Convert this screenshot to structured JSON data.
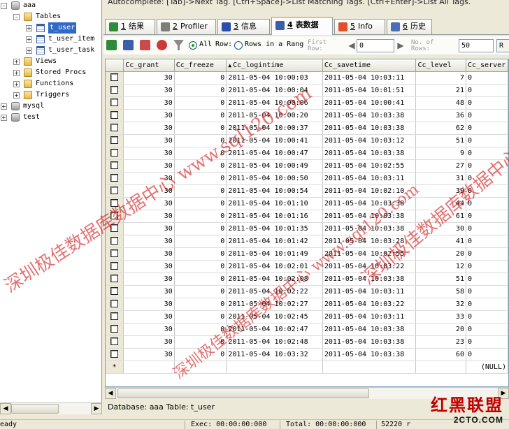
{
  "tree": {
    "items": [
      {
        "label": "aaa",
        "icon": "database-icon",
        "level": 0,
        "expander": "-"
      },
      {
        "label": "Tables",
        "icon": "folder-icon",
        "level": 1,
        "expander": "-"
      },
      {
        "label": "t_user",
        "icon": "table-icon",
        "level": 2,
        "expander": "+",
        "selected": true
      },
      {
        "label": "t_user_item",
        "icon": "table-icon",
        "level": 2,
        "expander": "+"
      },
      {
        "label": "t_user_task",
        "icon": "table-icon",
        "level": 2,
        "expander": "+"
      },
      {
        "label": "Views",
        "icon": "folder-icon",
        "level": 1,
        "expander": "+"
      },
      {
        "label": "Stored Procs",
        "icon": "folder-icon",
        "level": 1,
        "expander": "+"
      },
      {
        "label": "Functions",
        "icon": "folder-icon",
        "level": 1,
        "expander": "+"
      },
      {
        "label": "Triggers",
        "icon": "folder-icon",
        "level": 1,
        "expander": "+"
      },
      {
        "label": "mysql",
        "icon": "database-icon",
        "level": 0,
        "expander": "+"
      },
      {
        "label": "test",
        "icon": "database-icon",
        "level": 0,
        "expander": "+"
      }
    ]
  },
  "autocomplete_hint": "Autocomplete: [Tab]->Next Tag. [Ctrl+Space]->List Matching Tags. [Ctrl+Enter]->List All Tags.",
  "tabs": [
    {
      "num": "1",
      "label": "结果",
      "icon": "grid-icon",
      "color": "#2f8a3a"
    },
    {
      "num": "2",
      "label": "Profiler",
      "icon": "profiler-icon",
      "color": "#7d7d7d"
    },
    {
      "num": "3",
      "label": "信息",
      "icon": "info-icon",
      "color": "#2b4fa8"
    },
    {
      "num": "4",
      "label": "表数据",
      "icon": "table-data-icon",
      "color": "#3b5fa6",
      "active": true
    },
    {
      "num": "5",
      "label": "Info",
      "icon": "objects-icon",
      "color": "#e0502a"
    },
    {
      "num": "6",
      "label": "历史",
      "icon": "history-icon",
      "color": "#4a6fb5"
    }
  ],
  "toolbar": {
    "all_rows_label": "All",
    "row_label": "Row:",
    "rows_in_range_label": "Rows in a Rang",
    "first_row_label": "First\nRow:",
    "first_row_value": "0",
    "no_of_rows_label": "No. of\nRows:",
    "no_of_rows_value": "50",
    "refresh_label": "R"
  },
  "grid": {
    "columns": [
      "Cc_grant",
      "Cc_freeze",
      "Cc_logintime",
      "Cc_savetime",
      "Cc_level",
      "Cc_server"
    ],
    "sorted_column": "Cc_logintime",
    "rows": [
      [
        "30",
        "0",
        "2011-05-04 10:00:03",
        "2011-05-04 10:03:11",
        "7",
        "0"
      ],
      [
        "30",
        "0",
        "2011-05-04 10:00:04",
        "2011-05-04 10:01:51",
        "21",
        "0"
      ],
      [
        "30",
        "0",
        "2011-05-04 10:00:06",
        "2011-05-04 10:00:41",
        "48",
        "0"
      ],
      [
        "30",
        "0",
        "2011-05-04 10:00:20",
        "2011-05-04 10:03:38",
        "36",
        "0"
      ],
      [
        "30",
        "0",
        "2011-05-04 10:00:37",
        "2011-05-04 10:03:38",
        "62",
        "0"
      ],
      [
        "30",
        "0",
        "2011-05-04 10:00:41",
        "2011-05-04 10:03:12",
        "51",
        "0"
      ],
      [
        "30",
        "0",
        "2011-05-04 10:00:47",
        "2011-05-04 10:03:38",
        "9",
        "0"
      ],
      [
        "30",
        "0",
        "2011-05-04 10:00:49",
        "2011-05-04 10:02:55",
        "27",
        "0"
      ],
      [
        "30",
        "0",
        "2011-05-04 10:00:50",
        "2011-05-04 10:03:11",
        "31",
        "0"
      ],
      [
        "30",
        "0",
        "2011-05-04 10:00:54",
        "2011-05-04 10:02:10",
        "39",
        "0"
      ],
      [
        "30",
        "0",
        "2011-05-04 10:01:10",
        "2011-05-04 10:03:38",
        "44",
        "0"
      ],
      [
        "30",
        "0",
        "2011-05-04 10:01:16",
        "2011-05-04 10:03:38",
        "61",
        "0"
      ],
      [
        "30",
        "0",
        "2011-05-04 10:01:35",
        "2011-05-04 10:03:38",
        "30",
        "0"
      ],
      [
        "30",
        "0",
        "2011-05-04 10:01:42",
        "2011-05-04 10:03:28",
        "41",
        "0"
      ],
      [
        "30",
        "0",
        "2011-05-04 10:01:49",
        "2011-05-04 10:02:55",
        "20",
        "0"
      ],
      [
        "30",
        "0",
        "2011-05-04 10:02:01",
        "2011-05-04 10:03:22",
        "12",
        "0"
      ],
      [
        "30",
        "0",
        "2011-05-04 10:02:08",
        "2011-05-04 10:03:38",
        "51",
        "0"
      ],
      [
        "30",
        "0",
        "2011-05-04 10:02:22",
        "2011-05-04 10:03:11",
        "58",
        "0"
      ],
      [
        "30",
        "0",
        "2011-05-04 10:02:27",
        "2011-05-04 10:03:22",
        "32",
        "0"
      ],
      [
        "30",
        "0",
        "2011-05-04 10:02:45",
        "2011-05-04 10:03:11",
        "33",
        "0"
      ],
      [
        "30",
        "0",
        "2011-05-04 10:02:47",
        "2011-05-04 10:03:38",
        "20",
        "0"
      ],
      [
        "30",
        "0",
        "2011-05-04 10:02:48",
        "2011-05-04 10:03:38",
        "23",
        "0"
      ],
      [
        "30",
        "0",
        "2011-05-04 10:03:32",
        "2011-05-04 10:03:38",
        "60",
        "0"
      ]
    ],
    "new_row_marker": "*",
    "null_text": "(NULL)"
  },
  "db_info": "Database: aaa Table: t_user",
  "status": {
    "ready": "eady",
    "exec": "Exec: 00:00:00:000",
    "total": "Total: 00:00:00:000",
    "rows": "52220 r"
  },
  "watermark": {
    "text_1": "深圳极佳数据库数据中心 www.sql120.com",
    "text_2": "深圳极佳数据库数据中心 www.sql120.com",
    "text_3": "深圳极佳数据库数据中心 www.sql120.com",
    "badge_title": "红黑联盟",
    "badge_url": "2CTO.COM",
    "color": "#cc0000"
  }
}
